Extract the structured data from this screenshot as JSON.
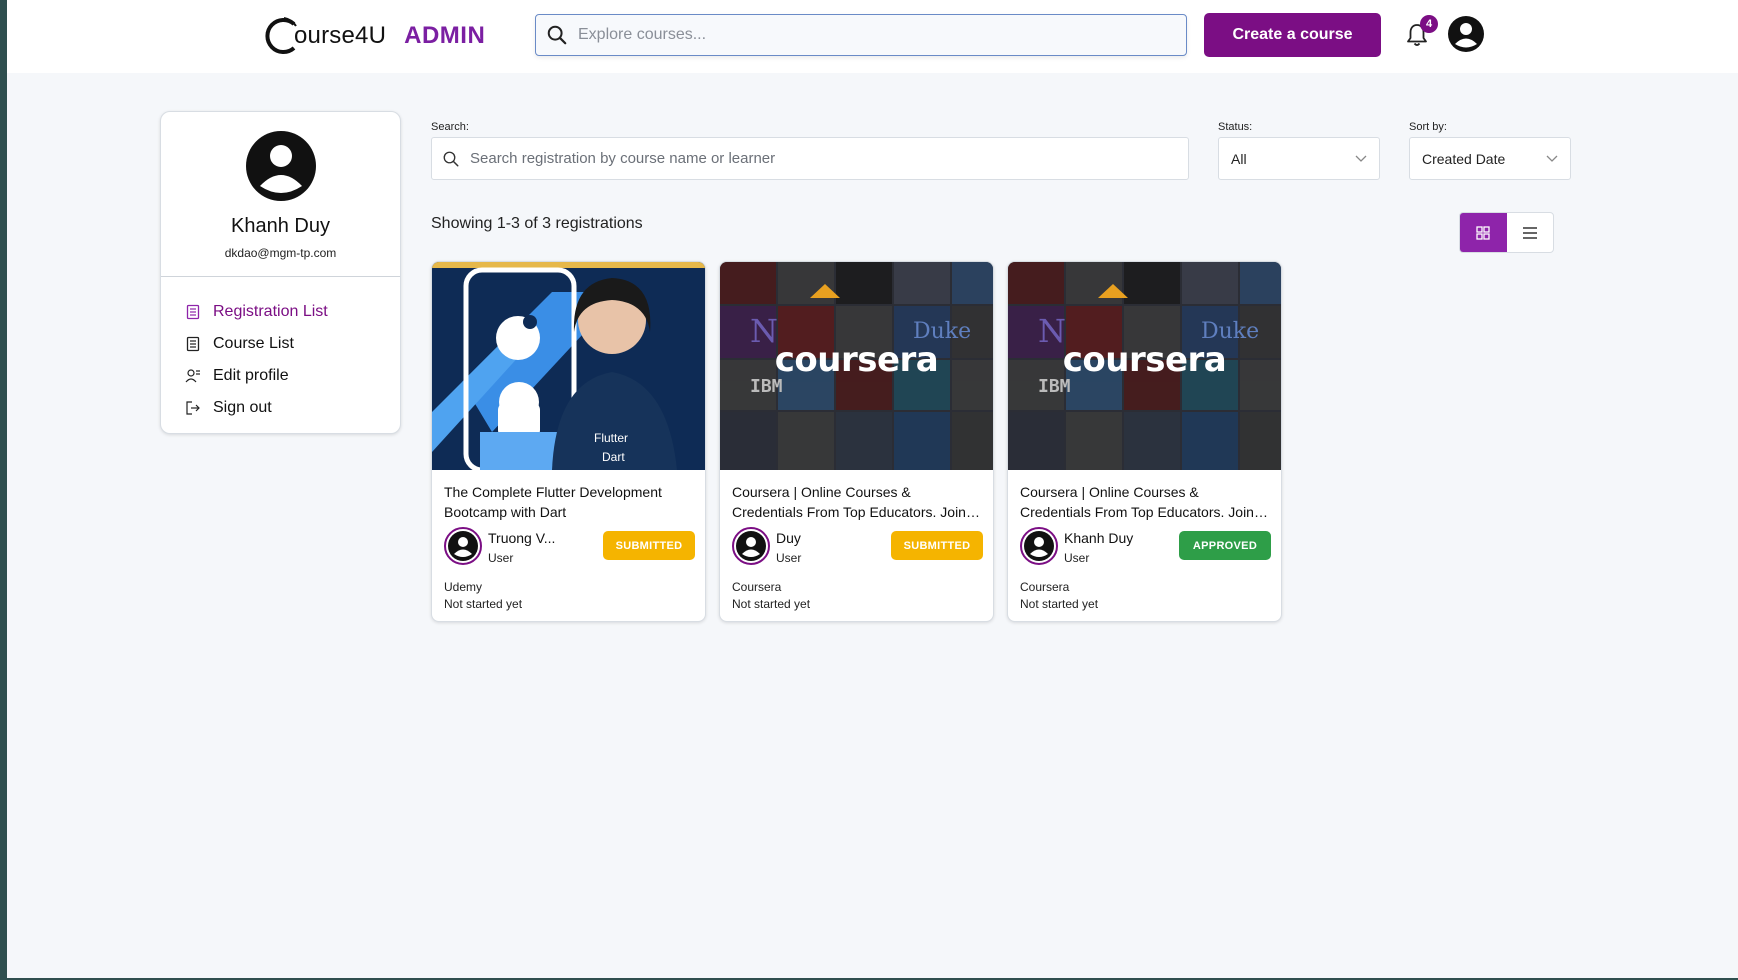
{
  "header": {
    "brand": "ourse4U",
    "admin_label": "ADMIN",
    "search_placeholder": "Explore courses...",
    "create_button": "Create a course",
    "notification_count": "4"
  },
  "sidebar": {
    "name": "Khanh Duy",
    "email": "dkdao@mgm-tp.com",
    "items": [
      {
        "label": "Registration List",
        "icon": "list-icon",
        "active": true
      },
      {
        "label": "Course List",
        "icon": "document-icon",
        "active": false
      },
      {
        "label": "Edit profile",
        "icon": "user-edit-icon",
        "active": false
      },
      {
        "label": "Sign out",
        "icon": "sign-out-icon",
        "active": false
      }
    ]
  },
  "filters": {
    "search_label": "Search:",
    "search_placeholder": "Search registration by course name or learner",
    "status_label": "Status:",
    "status_value": "All",
    "sort_label": "Sort by:",
    "sort_value": "Created Date"
  },
  "results": {
    "showing_text": "Showing 1-3 of 3 registrations",
    "view_mode": "grid"
  },
  "colors": {
    "brand_purple": "#7b0e84",
    "submitted": "#f5b400",
    "approved": "#2e9e48"
  },
  "cards": [
    {
      "title": "The Complete Flutter Development Bootcamp with Dart",
      "learner_name": "Truong V...",
      "learner_role": "User",
      "status": "SUBMITTED",
      "provider": "Udemy",
      "progress": "Not started yet",
      "thumb": "flutter",
      "thumb_text": "Flutter",
      "thumb_text2": "Dart"
    },
    {
      "title": "Coursera | Online Courses & Credentials From Top Educators. Join for Free",
      "learner_name": "Duy",
      "learner_role": "User",
      "status": "SUBMITTED",
      "provider": "Coursera",
      "progress": "Not started yet",
      "thumb": "coursera",
      "thumb_text": "coursera"
    },
    {
      "title": "Coursera | Online Courses & Credentials From Top Educators. Join for Free",
      "learner_name": "Khanh Duy",
      "learner_role": "User",
      "status": "APPROVED",
      "provider": "Coursera",
      "progress": "Not started yet",
      "thumb": "coursera",
      "thumb_text": "coursera"
    }
  ]
}
